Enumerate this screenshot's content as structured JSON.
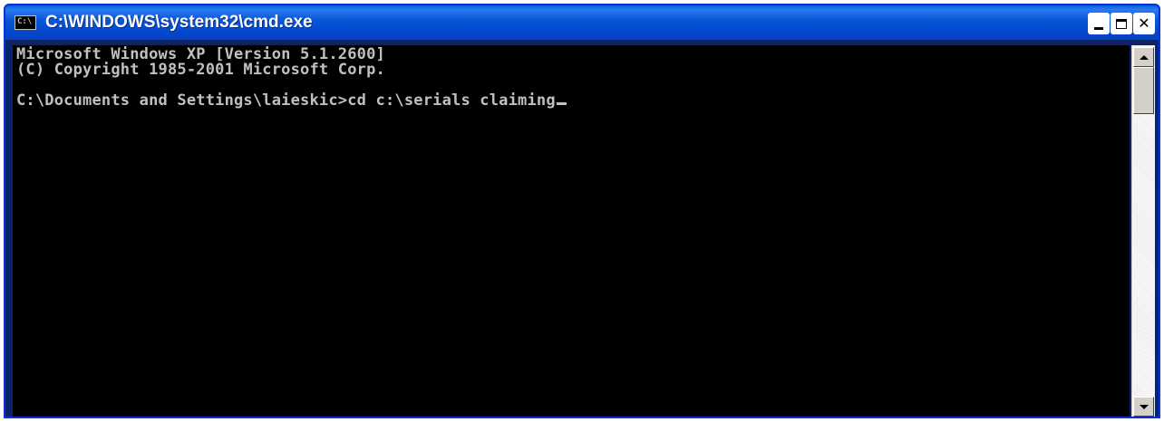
{
  "window": {
    "title": "C:\\WINDOWS\\system32\\cmd.exe",
    "app_icon_text": "C:\\"
  },
  "titlebar_buttons": {
    "minimize_icon": "minimize-icon",
    "maximize_icon": "maximize-icon",
    "close_icon": "close-icon",
    "close_glyph": "✕"
  },
  "console": {
    "lines": [
      "Microsoft Windows XP [Version 5.1.2600]",
      "(C) Copyright 1985-2001 Microsoft Corp.",
      "C:\\Documents and Settings\\laieskic>cd c:\\serials claiming"
    ],
    "text_color": "#c0c0c0",
    "background_color": "#000000"
  },
  "scrollbar": {
    "up_icon": "arrow-up-icon",
    "down_icon": "arrow-down-icon"
  },
  "colors": {
    "titlebar": "#0249cf",
    "frame": "#0831d9"
  }
}
